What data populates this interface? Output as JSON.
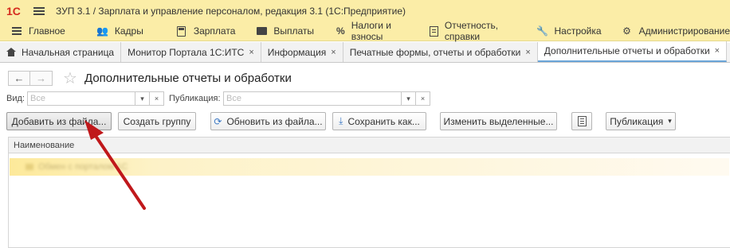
{
  "titlebar": {
    "logo": "1С",
    "title": "ЗУП 3.1 / Зарплата и управление персоналом, редакция 3.1  (1С:Предприятие)"
  },
  "sections": [
    {
      "label": "Главное",
      "icon": "lines-icon"
    },
    {
      "label": "Кадры",
      "icon": "people-icon"
    },
    {
      "label": "Зарплата",
      "icon": "calculator-icon"
    },
    {
      "label": "Выплаты",
      "icon": "wallet-icon"
    },
    {
      "label": "Налоги и взносы",
      "icon": "percent-icon"
    },
    {
      "label": "Отчетность, справки",
      "icon": "document-icon"
    },
    {
      "label": "Настройка",
      "icon": "wrench-icon"
    },
    {
      "label": "Администрирование",
      "icon": "gear-icon"
    }
  ],
  "tabs": [
    {
      "label": "Начальная страница"
    },
    {
      "label": "Монитор Портала 1С:ИТС",
      "close": "×"
    },
    {
      "label": "Информация",
      "close": "×"
    },
    {
      "label": "Печатные формы, отчеты и обработки",
      "close": "×"
    },
    {
      "label": "Дополнительные отчеты и обработки",
      "close": "×",
      "active": true
    }
  ],
  "form": {
    "title": "Дополнительные отчеты и обработки",
    "back": "←",
    "forward": "→",
    "star": "☆"
  },
  "filters": {
    "kind_label": "Вид:",
    "kind_placeholder": "Все",
    "publication_label": "Публикация:",
    "publication_placeholder": "Все",
    "dropdown": "▾",
    "clear": "×"
  },
  "toolbar": {
    "add_from_file": "Добавить из файла...",
    "create_group": "Создать группу",
    "update_from_file": "Обновить из файла...",
    "save_as": "Сохранить как...",
    "change_selected": "Изменить выделенные...",
    "publication": "Публикация",
    "publication_arrow": "▾"
  },
  "table": {
    "column_name": "Наименование",
    "rows": [
      {
        "label": "Обмен с порталом 1С"
      }
    ]
  },
  "colors": {
    "titlebar_bg": "#fbeda7",
    "logo": "#d52b1e",
    "accent_tab": "#6aa4d8",
    "annotation_arrow": "#c0181b"
  }
}
